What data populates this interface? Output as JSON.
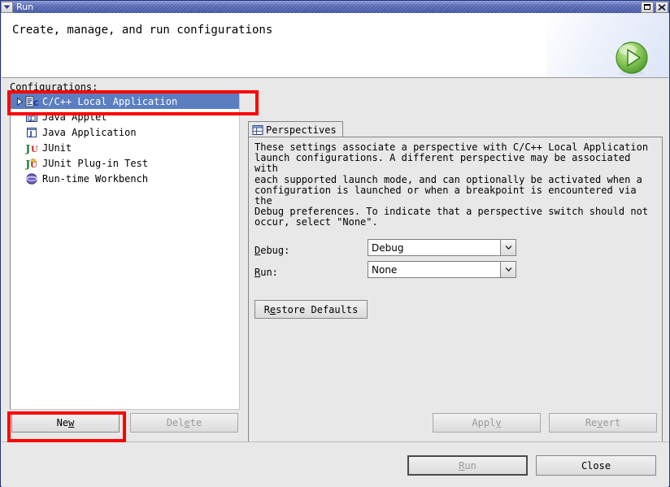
{
  "window": {
    "title": "Run",
    "menu_icon": "chevron-down-icon",
    "controls": [
      {
        "name": "maximize-button",
        "glyph": "□"
      },
      {
        "name": "close-button",
        "glyph": "✖"
      }
    ]
  },
  "banner": {
    "title": "Create, manage, and run configurations",
    "icon": "run-play-icon",
    "icon_color": "#6fbf4a"
  },
  "configurations": {
    "label": "Configurations:",
    "items": [
      {
        "label": "C/C++ Local Application",
        "icon": "cpp-config-icon",
        "selected": true,
        "expandable": true
      },
      {
        "label": "Java Applet",
        "icon": "java-applet-icon",
        "selected": false,
        "expandable": false
      },
      {
        "label": "Java Application",
        "icon": "java-application-icon",
        "selected": false,
        "expandable": false
      },
      {
        "label": "JUnit",
        "icon": "junit-icon",
        "selected": false,
        "expandable": false
      },
      {
        "label": "JUnit Plug-in Test",
        "icon": "junit-plugin-test-icon",
        "selected": false,
        "expandable": false
      },
      {
        "label": "Run-time Workbench",
        "icon": "runtime-workbench-icon",
        "selected": false,
        "expandable": false
      }
    ],
    "selection_color": "#5a7ec0"
  },
  "tabs": [
    {
      "label": "Perspectives",
      "icon": "perspectives-icon",
      "active": true
    }
  ],
  "perspectives": {
    "description": "These settings associate a perspective with C/C++ Local Application\nlaunch configurations. A different perspective may be associated with\neach supported launch mode, and can optionally be activated when a\nconfiguration is launched or when a breakpoint is encountered via the\nDebug preferences. To indicate that a perspective switch should not\noccur, select \"None\".",
    "fields": [
      {
        "label_prefix": "D",
        "label_rest": "ebug:",
        "value": "Debug",
        "name": "debug-perspective-select"
      },
      {
        "label_prefix": "R",
        "label_rest": "un:",
        "value": "None",
        "name": "run-perspective-select"
      }
    ],
    "restore_defaults": {
      "prefix": "R",
      "mnemonic": "e",
      "rest": "store Defaults"
    }
  },
  "buttons": {
    "new": {
      "prefix": "Ne",
      "mnemonic": "w",
      "rest": "",
      "enabled": true
    },
    "delete": {
      "prefix": "Del",
      "mnemonic": "e",
      "rest": "te",
      "enabled": false
    },
    "apply": {
      "prefix": "Appl",
      "mnemonic": "y",
      "rest": "",
      "enabled": false
    },
    "revert": {
      "prefix": "Re",
      "mnemonic": "v",
      "rest": "ert",
      "enabled": false
    },
    "run": {
      "prefix": "",
      "mnemonic": "R",
      "rest": "un",
      "enabled": false,
      "default": true
    },
    "close": {
      "prefix": "Close",
      "mnemonic": "",
      "rest": "",
      "enabled": true
    }
  },
  "annotations": {
    "color": "#ff0000",
    "boxes": [
      {
        "name": "annotation-tree-selection",
        "target": "C/C++ Local Application"
      },
      {
        "name": "annotation-new-button",
        "target": "New"
      }
    ]
  }
}
